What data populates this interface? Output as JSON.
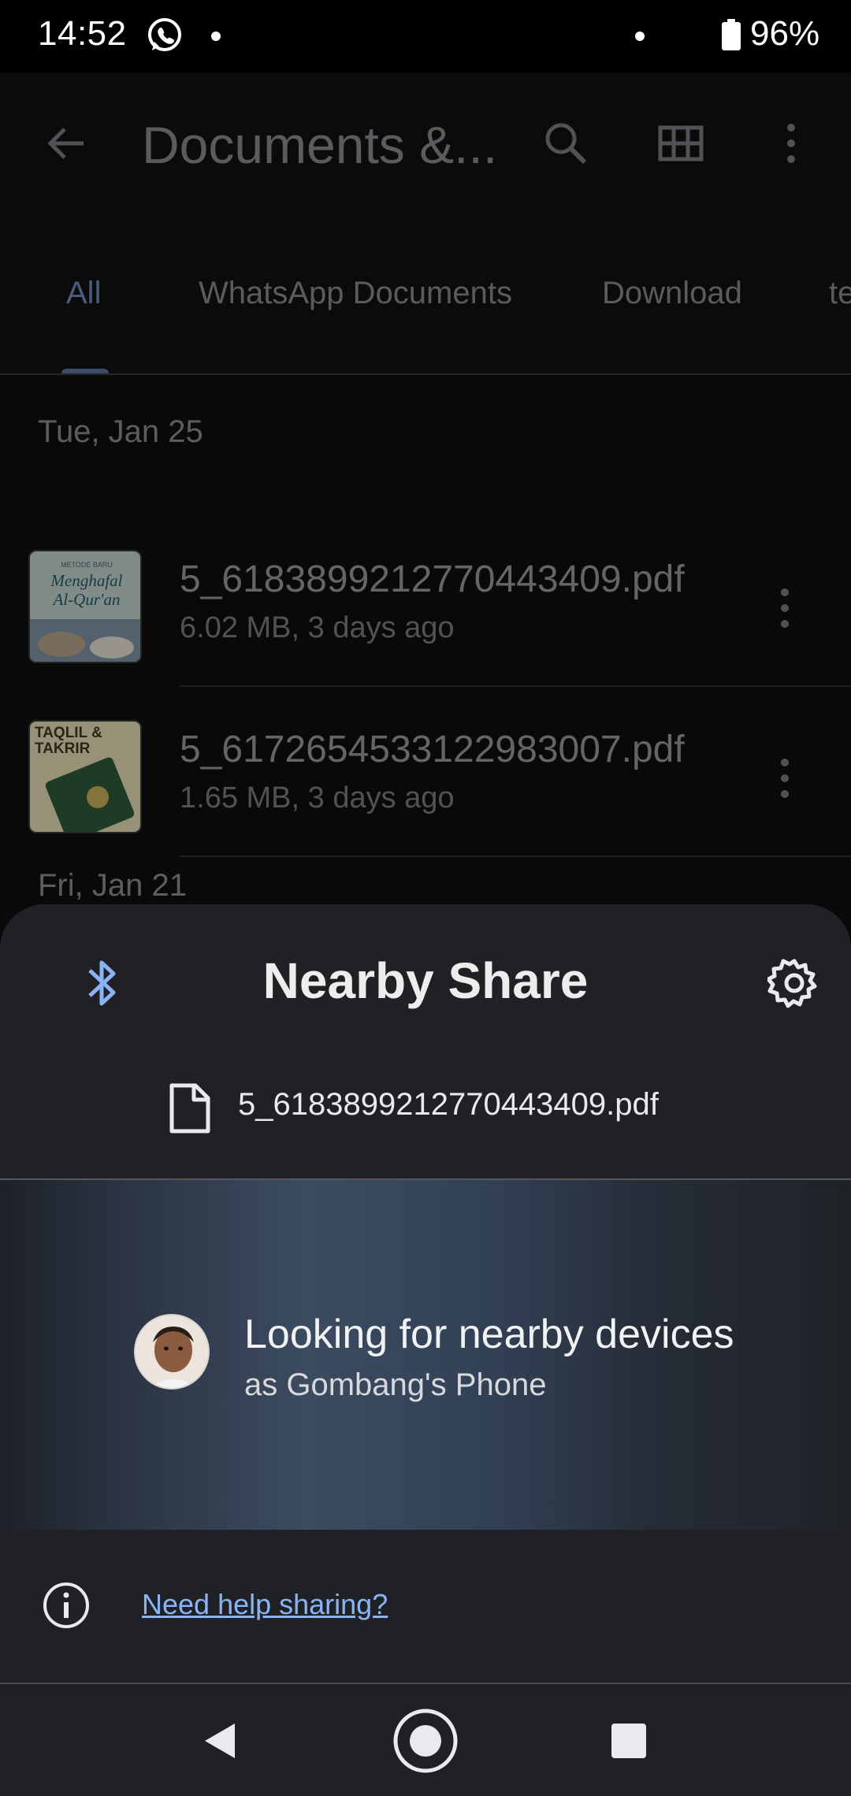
{
  "status_bar": {
    "time": "14:52",
    "battery_percent": "96%",
    "notification_icons": [
      "whatsapp-icon",
      "dot-icon"
    ]
  },
  "app": {
    "title": "Documents &...",
    "actions": [
      "back-arrow-icon",
      "search-icon",
      "grid-view-icon",
      "more-vert-icon"
    ],
    "tabs": [
      {
        "label": "All",
        "active": true
      },
      {
        "label": "WhatsApp Documents",
        "active": false
      },
      {
        "label": "Download",
        "active": false
      },
      {
        "label": "te",
        "active": false
      }
    ],
    "sections": [
      {
        "date": "Tue, Jan 25",
        "files": [
          {
            "name": "5_6183899212770443409.pdf",
            "meta": "6.02 MB, 3 days ago",
            "thumb": "Menghafal Al-Qur'an cover"
          },
          {
            "name": "5_6172654533122983007.pdf",
            "meta": "1.65 MB, 3 days ago",
            "thumb": "Taqlil & Takrir cover"
          }
        ]
      },
      {
        "date": "Fri, Jan 21",
        "files": []
      }
    ],
    "thumb_text": {
      "book1_kicker": "METODE BARU",
      "book1_title_1": "Menghafal",
      "book1_title_2": "Al-Qur'an",
      "book2_title_1": "TAQLIL &",
      "book2_title_2": "TAKRIR"
    }
  },
  "nearby_share": {
    "title": "Nearby Share",
    "file_name": "5_6183899212770443409.pdf",
    "status_title": "Looking for nearby devices",
    "status_subtitle": "as Gombang's Phone",
    "help_link": "Need help sharing?",
    "accent_color": "#8ab4f8"
  },
  "nav_bar": {
    "buttons": [
      "back-icon",
      "home-icon",
      "recents-icon"
    ]
  }
}
